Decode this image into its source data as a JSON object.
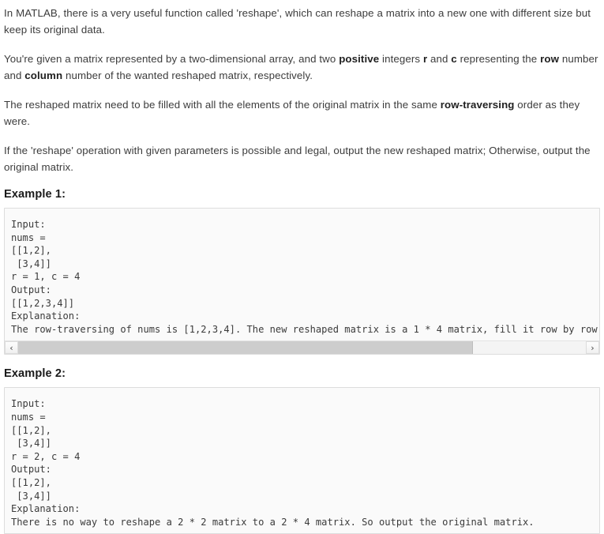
{
  "document": {
    "paragraphs": [
      {
        "id": "intro",
        "runs": [
          {
            "text": "In MATLAB, there is a very useful function called 'reshape', which can reshape a matrix into a new one with different size but keep its original data.",
            "bold": false
          }
        ]
      },
      {
        "id": "given",
        "runs": [
          {
            "text": "You're given a matrix represented by a two-dimensional array, and two ",
            "bold": false
          },
          {
            "text": "positive",
            "bold": true
          },
          {
            "text": " integers ",
            "bold": false
          },
          {
            "text": "r",
            "bold": true
          },
          {
            "text": " and ",
            "bold": false
          },
          {
            "text": "c",
            "bold": true
          },
          {
            "text": " representing the ",
            "bold": false
          },
          {
            "text": "row",
            "bold": true
          },
          {
            "text": " number and ",
            "bold": false
          },
          {
            "text": "column",
            "bold": true
          },
          {
            "text": " number of the wanted reshaped matrix, respectively.",
            "bold": false
          }
        ]
      },
      {
        "id": "fill-order",
        "runs": [
          {
            "text": "The reshaped matrix need to be filled with all the elements of the original matrix in the same ",
            "bold": false
          },
          {
            "text": "row-traversing",
            "bold": true
          },
          {
            "text": " order as they were.",
            "bold": false
          }
        ]
      },
      {
        "id": "legality",
        "runs": [
          {
            "text": "If the 'reshape' operation with given parameters is possible and legal, output the new reshaped matrix; Otherwise, output the original matrix.",
            "bold": false
          }
        ]
      }
    ],
    "examples": [
      {
        "heading": "Example 1:",
        "code": "Input:\nnums =\n[[1,2],\n [3,4]]\nr = 1, c = 4\nOutput:\n[[1,2,3,4]]\nExplanation:\nThe row-traversing of nums is [1,2,3,4]. The new reshaped matrix is a 1 * 4 matrix, fill it row by row by using the previous list.",
        "has_scrollbar": true,
        "scrollbar": {
          "left_arrow": "‹",
          "right_arrow": "›",
          "thumb_percent": 80,
          "thumb_offset_percent": 0
        }
      },
      {
        "heading": "Example 2:",
        "code": "Input:\nnums =\n[[1,2],\n [3,4]]\nr = 2, c = 4\nOutput:\n[[1,2],\n [3,4]]\nExplanation:\nThere is no way to reshape a 2 * 2 matrix to a 2 * 4 matrix. So output the original matrix.",
        "has_scrollbar": false,
        "scrollbar": null
      }
    ]
  },
  "colors": {
    "text": "#3c3c3c",
    "heading": "#1a1a1a",
    "code_bg": "#fafafa",
    "code_border": "#dddddd",
    "code_text": "#3b3b3b",
    "scroll_thumb": "#cdcdcd",
    "scroll_track": "#f4f4f4"
  }
}
